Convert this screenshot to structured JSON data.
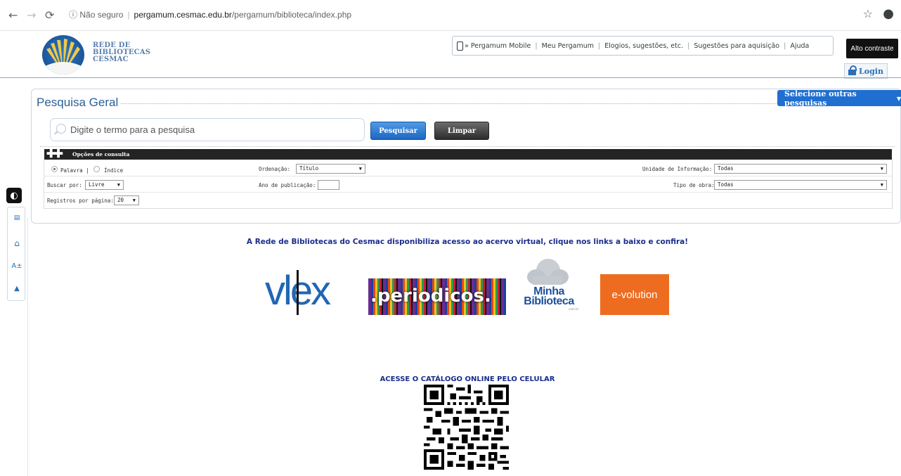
{
  "browser": {
    "security_label": "Não seguro",
    "url_host": "pergamum.cesmac.edu.br",
    "url_path": "/pergamum/biblioteca/index.php"
  },
  "header": {
    "logo_lines": [
      "REDE DE",
      "BIBLIOTECAS",
      "CESMAC"
    ],
    "nav": {
      "mobile": "» Pergamum Mobile",
      "meu": "Meu Pergamum",
      "elogios": "Elogios, sugestões, etc.",
      "sugestoes": "Sugestões para aquisição",
      "ajuda": "Ajuda"
    },
    "contrast_label": "Alto contraste",
    "login_label": "Login"
  },
  "a11y": {
    "contrast_icon": "half-circle-icon",
    "menu_icon": "menu-icon",
    "home_icon": "home-icon",
    "font_label": "A±",
    "up_icon": "arrow-up-icon"
  },
  "search": {
    "title": "Pesquisa Geral",
    "select_other": "Selecione outras pesquisas",
    "placeholder": "Digite o termo para a pesquisa",
    "search_button": "Pesquisar",
    "clear_button": "Limpar",
    "options_title": "Opções de consulta",
    "palavra": "Palavra |",
    "indice": "Índice",
    "ordenacao_label": "Ordenação:",
    "ordenacao_value": "Título",
    "unidade_label": "Unidade de Informação:",
    "unidade_value": "Todas",
    "buscar_label": "Buscar por:",
    "buscar_value": "Livre",
    "ano_label": "Ano de publicação:",
    "tipo_label": "Tipo de obra:",
    "tipo_value": "Todas",
    "registros_label": "Registros por página:",
    "registros_value": "20"
  },
  "content": {
    "announcement": "A Rede de Bibliotecas do Cesmac disponibiliza acesso ao acervo virtual, clique nos links a baixo e confira!",
    "vlex": "vlex",
    "periodicos": ".periodicos.",
    "minha_line1": "Minha",
    "minha_line2": "Biblioteca",
    "minha_sub": ".com.br",
    "evolution": "e-volution",
    "acesse": "ACESSE O CATÁLOGO ONLINE PELO CELULAR"
  },
  "colors": {
    "accent": "#1f6fd1",
    "title": "#2c5f98",
    "link_text": "#1a2d8c",
    "evolution": "#ee6c1f"
  }
}
